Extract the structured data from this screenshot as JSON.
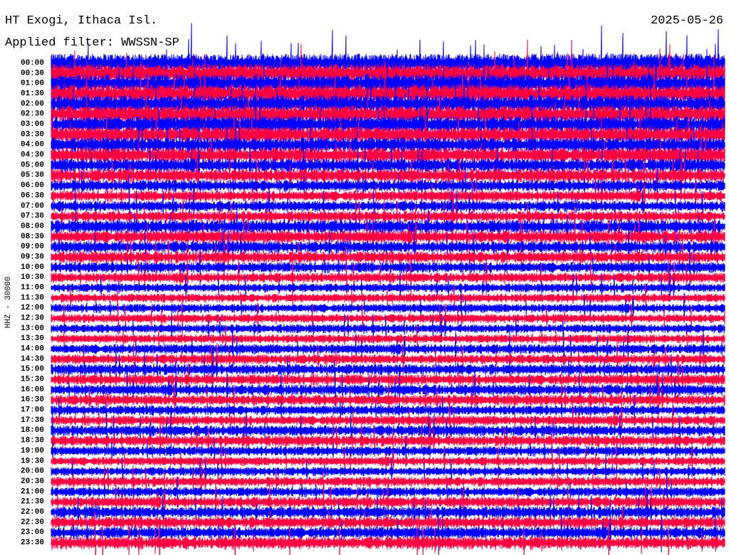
{
  "header": {
    "station": "HT Exogi, Ithaca Isl.",
    "date": "2025-05-26",
    "filter": "Applied filter: WWSSN-SP"
  },
  "chart_data": {
    "type": "line",
    "title": "HT Exogi, Ithaca Isl.",
    "ylabel": "HHZ - 30000",
    "colors": [
      "#0000ff",
      "#ff0040"
    ],
    "rows": [
      "00:00",
      "00:30",
      "01:00",
      "01:30",
      "02:00",
      "02:30",
      "03:00",
      "03:30",
      "04:00",
      "04:30",
      "05:00",
      "05:30",
      "06:00",
      "06:30",
      "07:00",
      "07:30",
      "08:00",
      "08:30",
      "09:00",
      "09:30",
      "10:00",
      "10:30",
      "11:00",
      "11:30",
      "12:00",
      "12:30",
      "13:00",
      "13:30",
      "14:00",
      "14:30",
      "15:00",
      "15:30",
      "16:00",
      "16:30",
      "17:00",
      "17:30",
      "18:00",
      "18:30",
      "19:00",
      "19:30",
      "20:00",
      "20:30",
      "21:00",
      "21:30",
      "22:00",
      "22:30",
      "23:00",
      "23:30"
    ],
    "noise_level": [
      1.0,
      1.0,
      1.0,
      1.0,
      0.95,
      0.95,
      0.9,
      0.85,
      0.8,
      0.8,
      0.7,
      0.7,
      0.6,
      0.55,
      0.55,
      0.55,
      0.7,
      0.65,
      0.6,
      0.6,
      0.55,
      0.5,
      0.45,
      0.45,
      0.45,
      0.45,
      0.45,
      0.45,
      0.5,
      0.5,
      0.55,
      0.55,
      0.55,
      0.55,
      0.5,
      0.5,
      0.55,
      0.55,
      0.5,
      0.45,
      0.45,
      0.5,
      0.5,
      0.55,
      0.6,
      0.6,
      0.6,
      0.65
    ]
  }
}
